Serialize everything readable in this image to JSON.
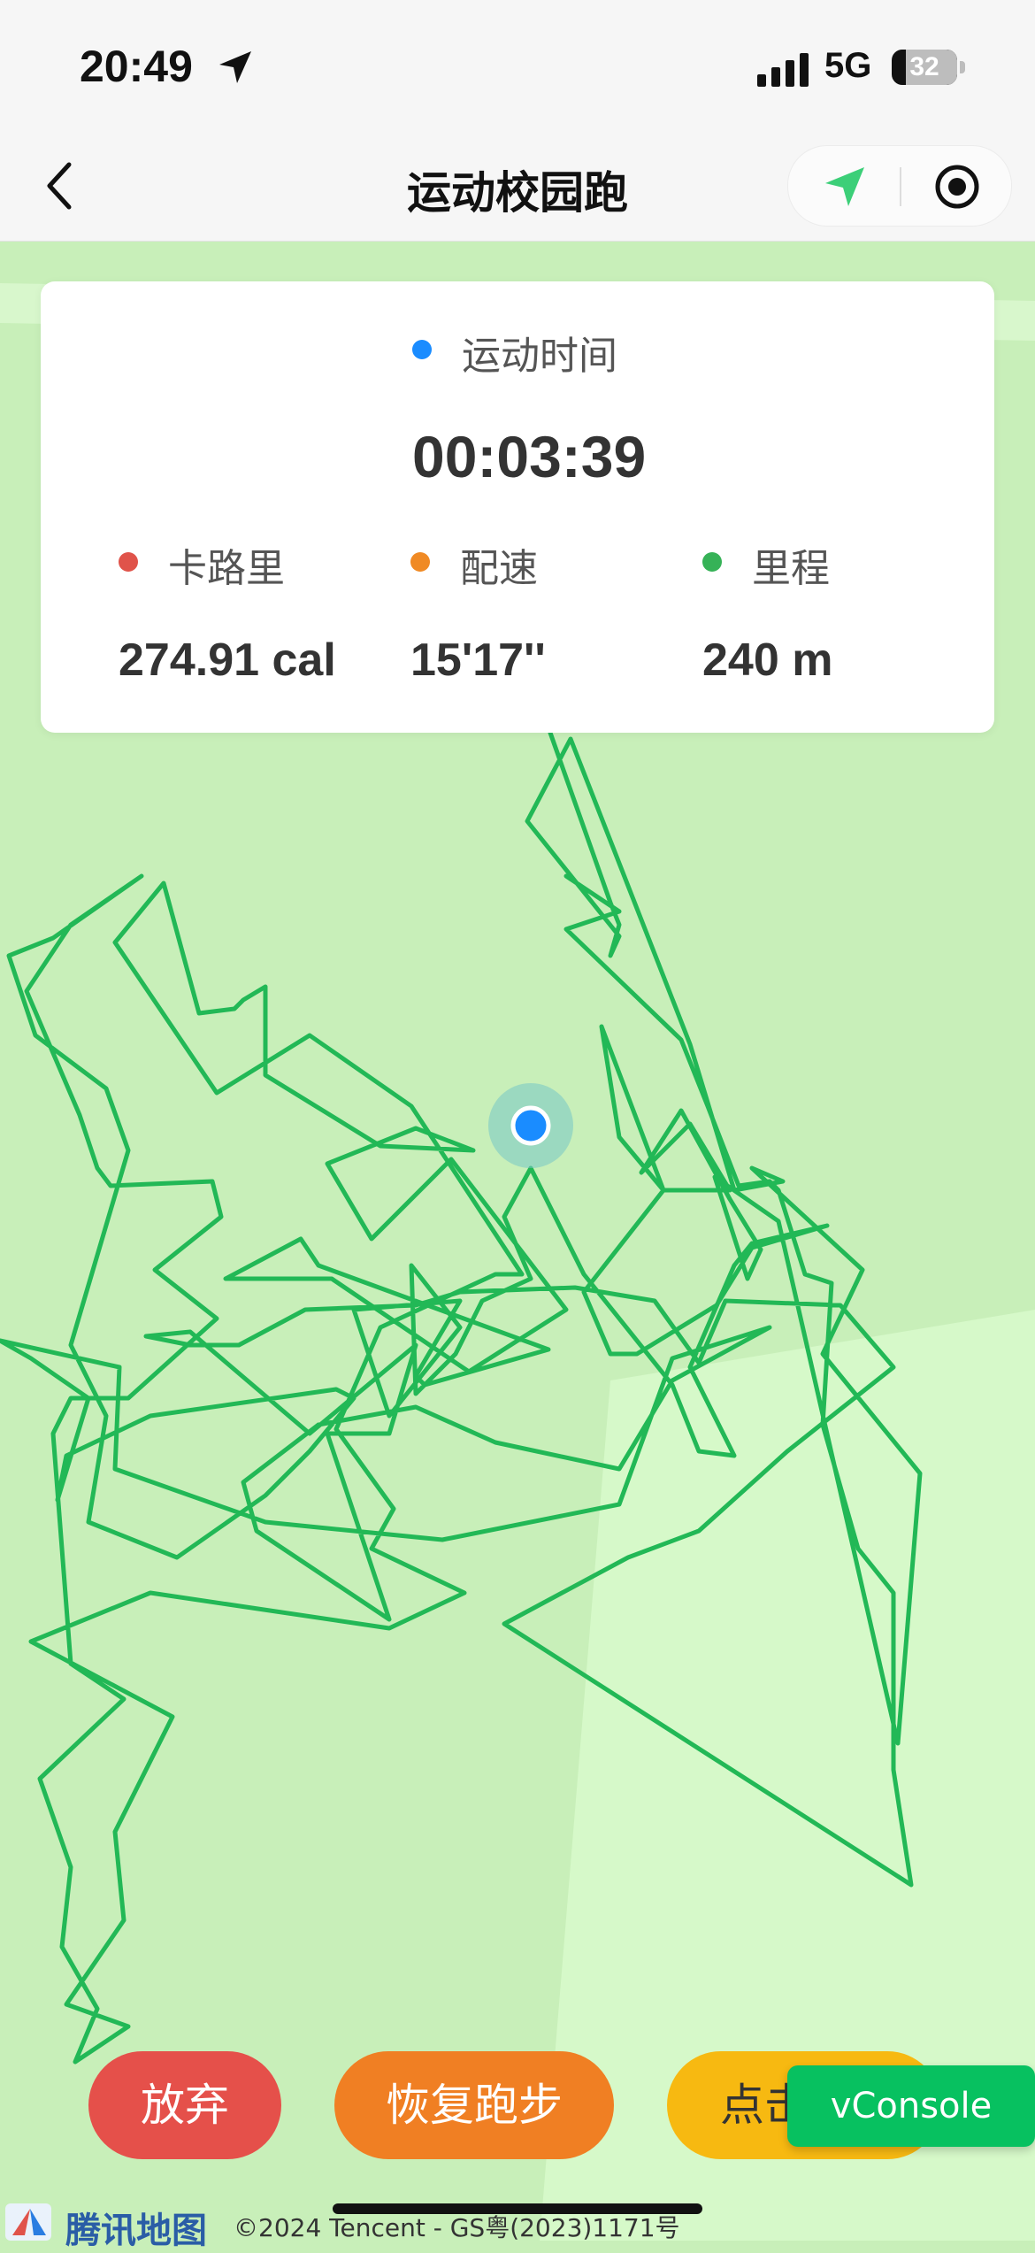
{
  "status_bar": {
    "time": "20:49",
    "network": "5G",
    "battery": "32"
  },
  "nav": {
    "title": "运动校园跑"
  },
  "stats": {
    "duration_label": "运动时间",
    "duration_value": "00:03:39",
    "calories_label": "卡路里",
    "calories_value": "274.91 cal",
    "pace_label": "配速",
    "pace_value": "15'17''",
    "distance_label": "里程",
    "distance_value": "240 m",
    "colors": {
      "duration": "#1a8cff",
      "calories": "#e0534a",
      "pace": "#f08a24",
      "distance": "#36b257"
    }
  },
  "actions": {
    "give_up": "放弃",
    "resume": "恢复跑步",
    "click": "点击",
    "vconsole": "vConsole",
    "colors": {
      "give_up": "#e5504a",
      "resume": "#f07f23",
      "click": "#f7b911",
      "vconsole": "#07c160"
    }
  },
  "map": {
    "provider": "腾讯地图",
    "copyright": "©2024 Tencent - GS粤(2023)1171号",
    "route_color": "#22b856"
  }
}
